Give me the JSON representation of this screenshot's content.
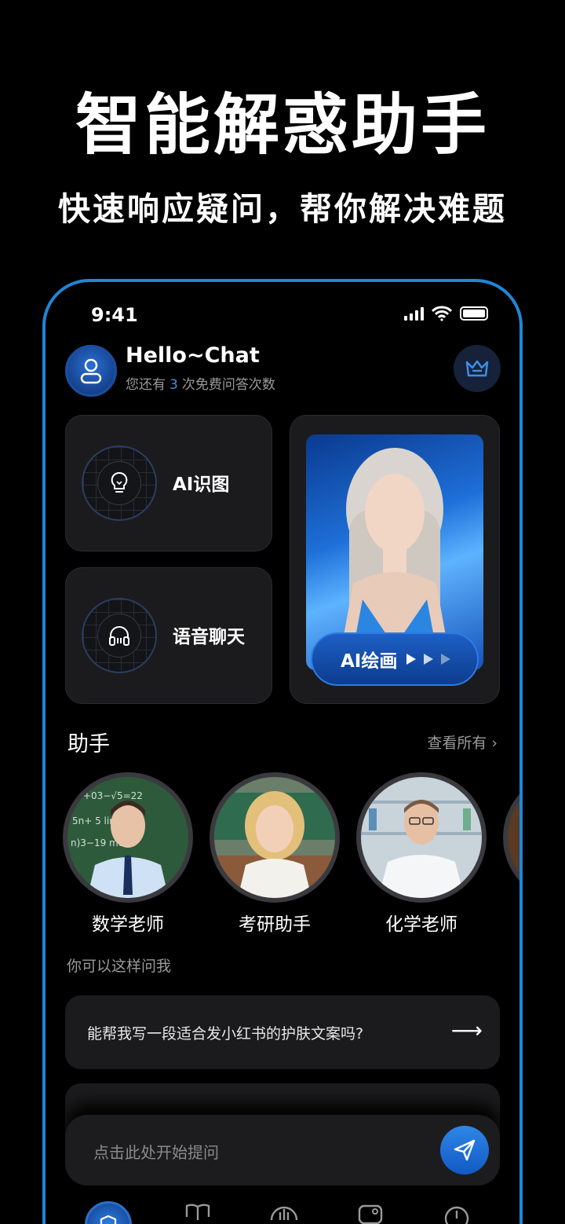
{
  "promo": {
    "title": "智能解惑助手",
    "subtitle": "快速响应疑问，帮你解决难题"
  },
  "status": {
    "time": "9:41"
  },
  "header": {
    "greeting": "Hello~Chat",
    "quota_prefix": "您还有",
    "quota_count": "3",
    "quota_suffix": "次免费问答次数"
  },
  "features": {
    "image_recognition": "AI识图",
    "voice_chat": "语音聊天",
    "ai_drawing": "AI绘画"
  },
  "assistants": {
    "title": "助手",
    "see_all": "查看所有",
    "items": [
      {
        "name": "数学老师"
      },
      {
        "name": "考研助手"
      },
      {
        "name": "化学老师"
      }
    ]
  },
  "suggestions": {
    "hint": "你可以这样问我",
    "items": [
      {
        "text": "能帮我写一段适合发小红书的护肤文案吗?"
      }
    ]
  },
  "input": {
    "placeholder": "点击此处开始提问"
  },
  "colors": {
    "accent": "#1f86d6",
    "card": "#1b1b1d",
    "muted": "#9a9a9a"
  }
}
